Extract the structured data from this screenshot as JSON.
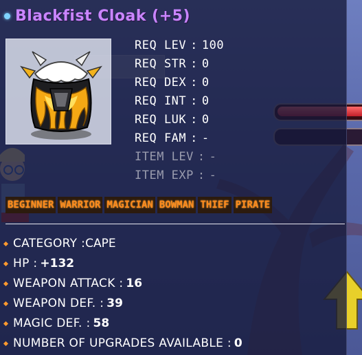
{
  "tooltip": {
    "title": "Blackfist Cloak (+5)",
    "title_color": "#c985ff",
    "icon": "blackfist-cloak-icon",
    "requirements": [
      {
        "label": "REQ LEV",
        "value": "100",
        "active": true
      },
      {
        "label": "REQ STR",
        "value": "0",
        "active": true
      },
      {
        "label": "REQ DEX",
        "value": "0",
        "active": true
      },
      {
        "label": "REQ INT",
        "value": "0",
        "active": true
      },
      {
        "label": "REQ LUK",
        "value": "0",
        "active": true
      },
      {
        "label": "REQ FAM",
        "value": "-",
        "active": true
      },
      {
        "label": "ITEM LEV",
        "value": "-",
        "active": false
      },
      {
        "label": "ITEM EXP",
        "value": "-",
        "active": false
      }
    ],
    "jobs": [
      "BEGINNER",
      "WARRIOR",
      "MAGICIAN",
      "BOWMAN",
      "THIEF",
      "PIRATE"
    ],
    "job_color": "#ff8a1c",
    "stats": [
      {
        "label": "CATEGORY :",
        "value": "CAPE",
        "bold_value": false
      },
      {
        "label": "HP :",
        "value": "+132",
        "bold_value": true
      },
      {
        "label": "WEAPON ATTACK :",
        "value": "16",
        "bold_value": true
      },
      {
        "label": "WEAPON DEF. :",
        "value": "39",
        "bold_value": true
      },
      {
        "label": "MAGIC DEF. :",
        "value": "58",
        "bold_value": true
      },
      {
        "label": "NUMBER OF UPGRADES AVAILABLE :",
        "value": "0",
        "bold_value": true
      }
    ]
  }
}
